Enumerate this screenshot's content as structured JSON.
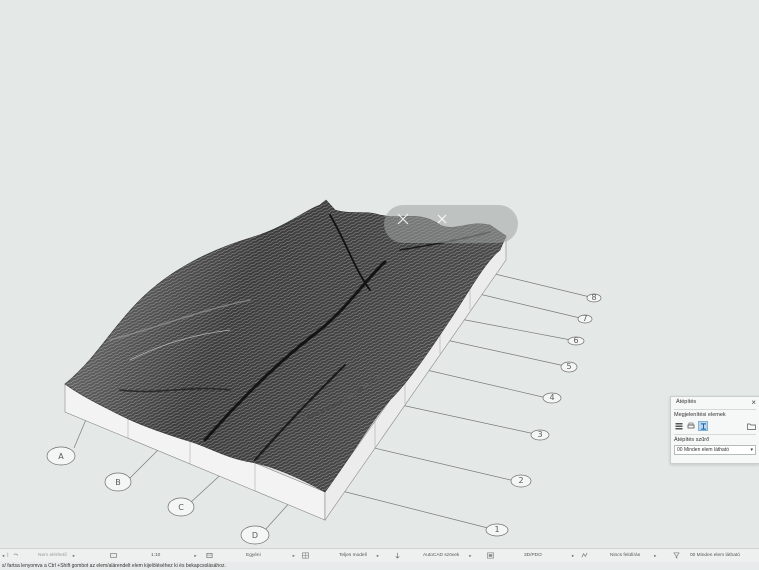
{
  "viewport": {
    "grid_labels_front": [
      "A",
      "B",
      "C",
      "D"
    ],
    "grid_labels_side": [
      "1",
      "2",
      "3",
      "4",
      "5",
      "6",
      "7",
      "8"
    ]
  },
  "panel": {
    "title": "Átépítés",
    "section1": "Megjelenítési elemek",
    "section2": "Átépítés szűrő",
    "filter_value": "00 Minden elem látható"
  },
  "statusbar": {
    "items": [
      {
        "icon": "undo-icon",
        "label": ""
      },
      {
        "icon": "layer-icon",
        "label": "Nem elérhető"
      },
      {
        "icon": "scale-icon",
        "label": "1:10"
      },
      {
        "icon": "pen-icon",
        "label": "Egyéni"
      },
      {
        "icon": "model-icon",
        "label": "Teljes modell"
      },
      {
        "icon": "dimension-icon",
        "label": "AutoCAD szövek"
      },
      {
        "icon": "view-icon",
        "label": "3D/PDO"
      },
      {
        "icon": "renovation-icon",
        "label": "Nincs felülírás"
      },
      {
        "icon": "filter-icon",
        "label": "00 Minden elem látható"
      }
    ]
  },
  "hint": "s/ fartsa lenyomva a Ctrl +Shift gombot az elem/alárendelt elem kijelöléséhez ki és bekapcsolásához."
}
